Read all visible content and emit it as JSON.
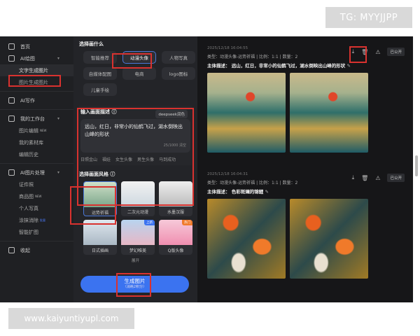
{
  "watermarks": {
    "top": "TG: MYYJJPP",
    "bottom": "www.kaiyuntiyupl.com"
  },
  "sidebar": {
    "items": [
      {
        "label": "首页",
        "icon": "home-icon"
      },
      {
        "label": "AI绘图",
        "icon": "image-icon",
        "caret": "▾"
      },
      {
        "label": "文字生成图片",
        "sub": true,
        "selected": true
      },
      {
        "label": "图片生成图片",
        "sub": true
      },
      {
        "label": "AI写作",
        "icon": "ai-icon"
      },
      {
        "label": "我的工作台",
        "icon": "chart-icon",
        "caret": "▾"
      },
      {
        "label": "图片编辑",
        "sub": true,
        "badge": "NEW"
      },
      {
        "label": "我的素材库",
        "sub": true
      },
      {
        "label": "编辑历史",
        "sub": true
      },
      {
        "label": "AI图片处理",
        "icon": "palette-icon",
        "caret": "▾"
      },
      {
        "label": "证件照",
        "sub": true
      },
      {
        "label": "商品图",
        "sub": true,
        "badge": "NEW"
      },
      {
        "label": "个人写真",
        "sub": true
      },
      {
        "label": "涂抹消除",
        "sub": true,
        "badge": "批量"
      },
      {
        "label": "智能扩图",
        "sub": true
      },
      {
        "label": "收起",
        "icon": "collapse-icon"
      }
    ]
  },
  "panel": {
    "choose_title": "选择画什么",
    "categories": [
      "智能推荐",
      "动漫头像",
      "人物写真",
      "自媒体配图",
      "电商",
      "logo图标",
      "儿童手绘"
    ],
    "selected_category": "动漫头像",
    "desc_title": "输入画面描述",
    "deepseek": "deepseek润色",
    "prompt": "远山，红日，非常小的仙鹤飞过，湖水倒映出山峰的形状",
    "count": "25/1000",
    "clear": "清空",
    "tags": [
      "日照金山",
      "福娃",
      "女生头像",
      "男生头像",
      "马到成功"
    ],
    "style_title": "选择画面风格",
    "styles": [
      {
        "label": "运势祈福"
      },
      {
        "label": "二次元动漫"
      },
      {
        "label": "水墨汉服"
      },
      {
        "label": "日式插画"
      },
      {
        "label": "梦幻唯美",
        "badge": "上新"
      },
      {
        "label": "Q版头像",
        "badge": "热门"
      }
    ],
    "expand": "展开",
    "generate": "生成图片",
    "generate_cost": "（消耗2积分）"
  },
  "results": [
    {
      "time": "2025/12/18 16:04:55",
      "meta": "类型：动漫头像-运势祈福 | 比例：1:1 | 数量：2",
      "main_label": "主体描述：",
      "main": "远山，红日，非常小的仙鹤飞过，湖水倒映出山峰的形状",
      "public": "已公开"
    },
    {
      "time": "2025/12/18 16:04:31",
      "meta": "类型：动漫头像-运势祈福 | 比例：1:1 | 数量：2",
      "main_label": "主体描述：",
      "main": "色彩斑斓的锦鲤",
      "public": "已公开"
    }
  ],
  "colors": {
    "accent": "#3b73f0",
    "highlight": "#d9322f"
  }
}
